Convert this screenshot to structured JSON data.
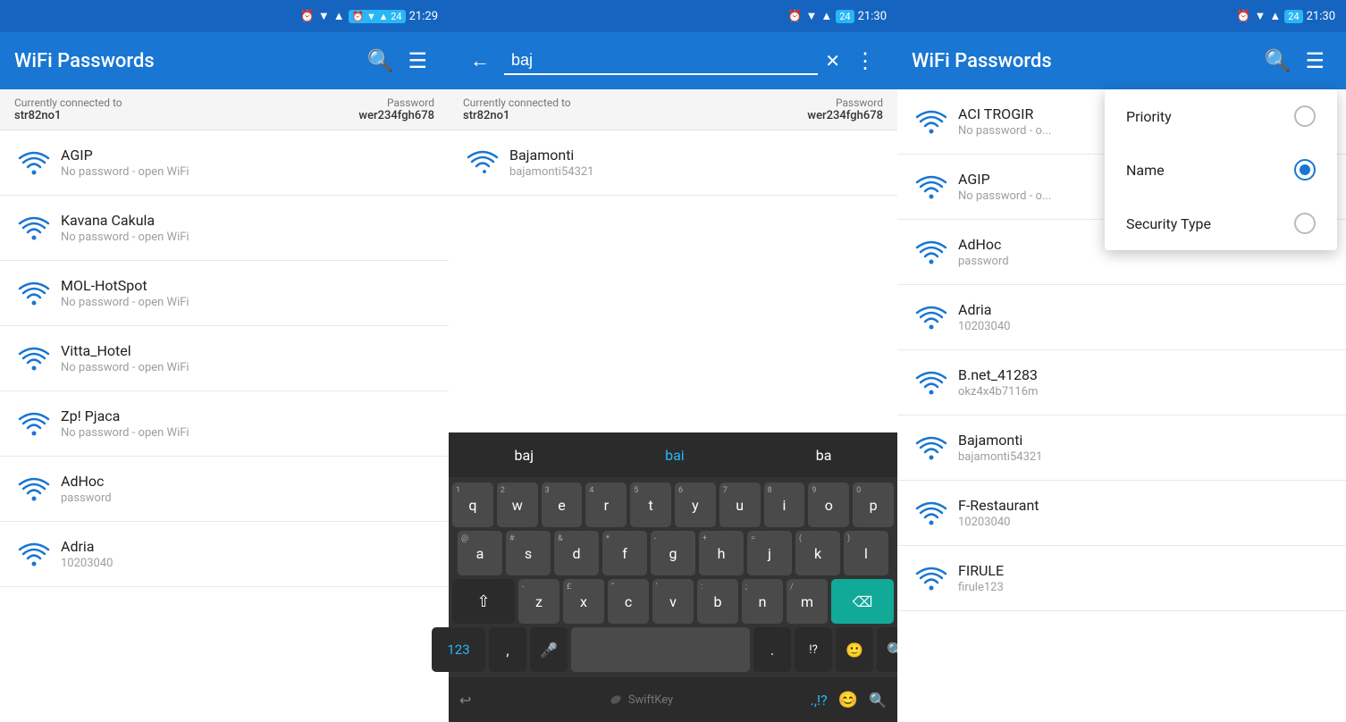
{
  "panel1": {
    "statusBar": {
      "time": "21:29",
      "icons": "⏰ ▼ ▲ 24"
    },
    "appBar": {
      "title": "WiFi Passwords",
      "searchLabel": "search",
      "filterLabel": "filter"
    },
    "connected": {
      "label": "Currently connected to",
      "network": "str82no1",
      "passwordLabel": "Password",
      "password": "wer234fgh678"
    },
    "items": [
      {
        "name": "AGIP",
        "sub": "No password - open WiFi"
      },
      {
        "name": "Kavana Cakula",
        "sub": "No password - open WiFi"
      },
      {
        "name": "MOL-HotSpot",
        "sub": "No password - open WiFi"
      },
      {
        "name": "Vitta_Hotel",
        "sub": "No password - open WiFi"
      },
      {
        "name": "Zp! Pjaca",
        "sub": "No password - open WiFi"
      },
      {
        "name": "AdHoc",
        "sub": "password"
      },
      {
        "name": "Adria",
        "sub": "10203040"
      }
    ]
  },
  "panel2": {
    "statusBar": {
      "time": "21:30"
    },
    "appBar": {
      "searchValue": "baj",
      "placeholder": "baj"
    },
    "connected": {
      "label": "Currently connected to",
      "network": "str82no1",
      "passwordLabel": "Password",
      "password": "wer234fgh678"
    },
    "searchResult": {
      "name": "Bajamonti",
      "sub": "bajamonti54321"
    },
    "keyboard": {
      "suggestions": [
        "baj",
        "bai",
        "ba"
      ],
      "highlightIndex": 1,
      "rows": [
        [
          {
            "label": "q",
            "sub": "1"
          },
          {
            "label": "w",
            "sub": "2"
          },
          {
            "label": "e",
            "sub": "3"
          },
          {
            "label": "r",
            "sub": "4"
          },
          {
            "label": "t",
            "sub": "5"
          },
          {
            "label": "y",
            "sub": "6"
          },
          {
            "label": "u",
            "sub": "7"
          },
          {
            "label": "i",
            "sub": "8"
          },
          {
            "label": "o",
            "sub": "9"
          },
          {
            "label": "p",
            "sub": "0"
          }
        ],
        [
          {
            "label": "a",
            "sub": "@"
          },
          {
            "label": "s",
            "sub": "#"
          },
          {
            "label": "d",
            "sub": "&"
          },
          {
            "label": "f",
            "sub": "*"
          },
          {
            "label": "g",
            "sub": "-"
          },
          {
            "label": "h",
            "sub": "+"
          },
          {
            "label": "j",
            "sub": "="
          },
          {
            "label": "k",
            "sub": "("
          },
          {
            "label": "l",
            "sub": ")"
          }
        ],
        [
          {
            "label": "⇧",
            "type": "shift"
          },
          {
            "label": "z",
            "sub": "-"
          },
          {
            "label": "x",
            "sub": "£"
          },
          {
            "label": "c",
            "sub": "\""
          },
          {
            "label": "v",
            "sub": "'"
          },
          {
            "label": "b",
            "sub": ":"
          },
          {
            "label": "n",
            "sub": ";"
          },
          {
            "label": "m",
            "sub": "/"
          },
          {
            "label": "⌫",
            "type": "delete"
          }
        ],
        [
          {
            "label": "123",
            "type": "numbers"
          },
          {
            "label": ",",
            "sub": ""
          },
          {
            "label": "🎤",
            "type": "mic"
          },
          {
            "label": "",
            "type": "space",
            "text": ""
          },
          {
            "label": ".",
            "sub": ""
          },
          {
            "label": "!?",
            "sub": ""
          },
          {
            "label": "😊",
            "type": "emoji"
          },
          {
            "label": "🔍",
            "type": "search"
          }
        ]
      ],
      "swiftkey": "SwiftKey"
    }
  },
  "panel3": {
    "statusBar": {
      "time": "21:30"
    },
    "appBar": {
      "title": "WiFi Passwords",
      "searchLabel": "search",
      "filterLabel": "filter"
    },
    "items": [
      {
        "name": "ACI TROGIR",
        "sub": "No password - o..."
      },
      {
        "name": "AGIP",
        "sub": "No password - o..."
      },
      {
        "name": "AdHoc",
        "sub": "password"
      },
      {
        "name": "Adria",
        "sub": "10203040"
      },
      {
        "name": "B.net_41283",
        "sub": "okz4x4b7116m"
      },
      {
        "name": "Bajamonti",
        "sub": "bajamonti54321"
      },
      {
        "name": "F-Restaurant",
        "sub": "10203040"
      },
      {
        "name": "FIRULE",
        "sub": "firule123"
      }
    ],
    "dropdown": {
      "items": [
        {
          "label": "Priority",
          "selected": false
        },
        {
          "label": "Name",
          "selected": true
        },
        {
          "label": "Security Type",
          "selected": false
        }
      ]
    }
  },
  "colors": {
    "blue": "#1976D2",
    "lightBlue": "#29B6F6",
    "wifiBlue": "#1976D2"
  }
}
